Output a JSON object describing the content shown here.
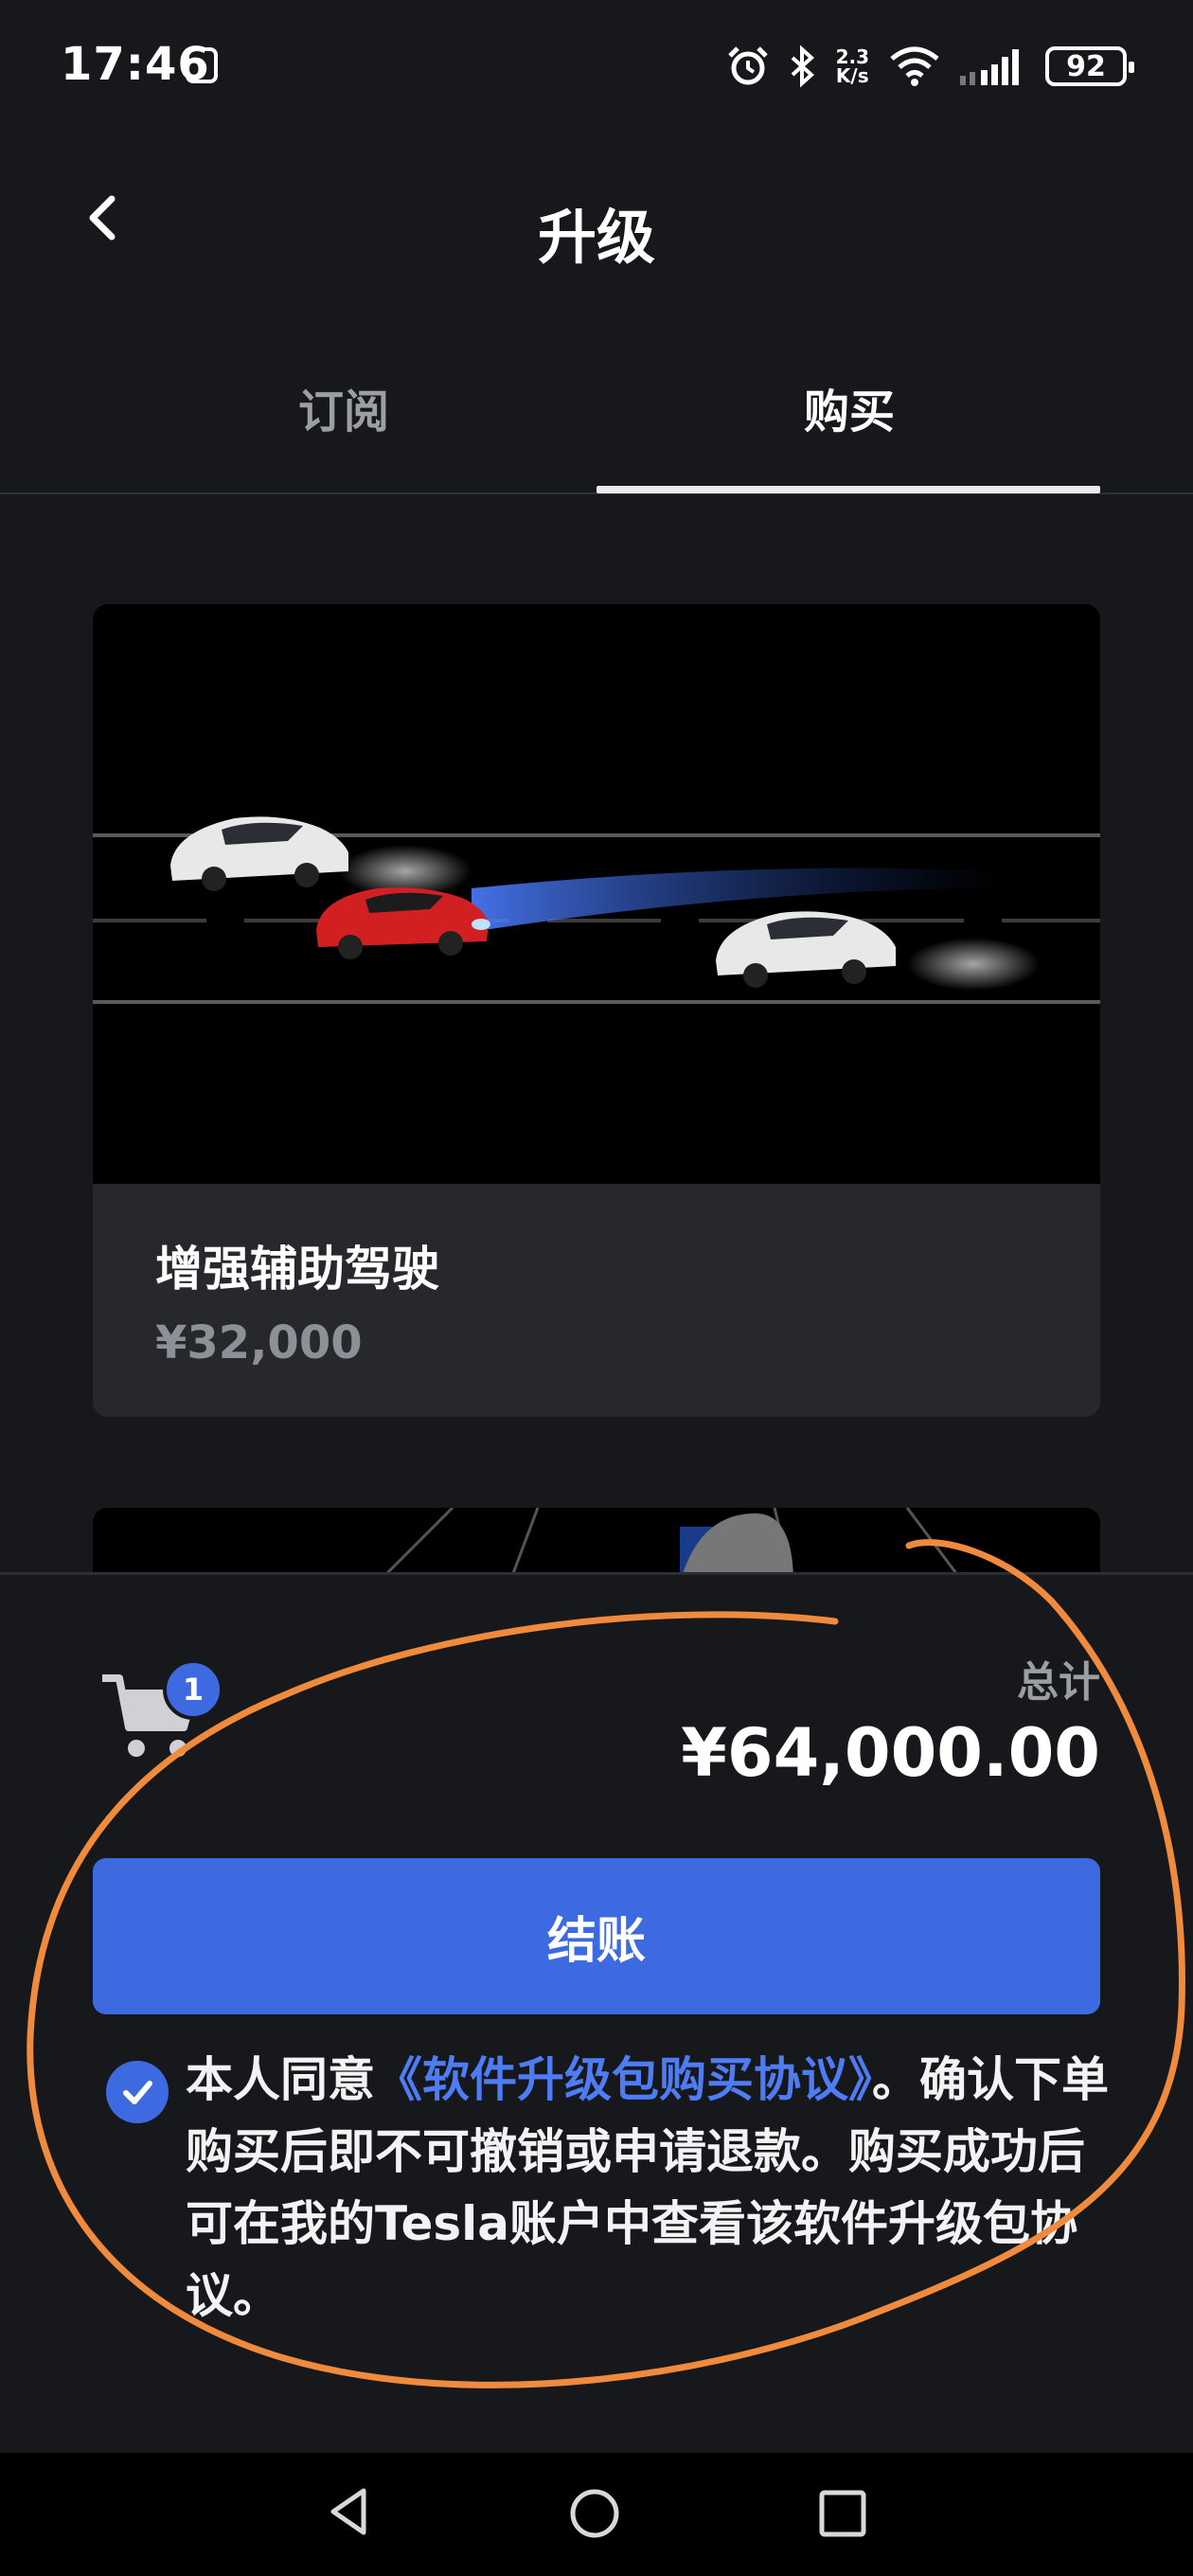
{
  "status_bar": {
    "time": "17:46",
    "network_speed_value": "2.3",
    "network_speed_unit": "K/s",
    "battery": "92"
  },
  "header": {
    "title": "升级"
  },
  "tabs": [
    {
      "label": "订阅",
      "active": false
    },
    {
      "label": "购买",
      "active": true
    }
  ],
  "product_card": {
    "title": "增强辅助驾驶",
    "price": "¥32,000"
  },
  "cart": {
    "badge_count": "1",
    "total_label": "总计",
    "total_amount": "¥64,000.00"
  },
  "checkout": {
    "button_label": "结账"
  },
  "agreement": {
    "checked": true,
    "text_prefix": "本人同意",
    "link_text": "《软件升级包购买协议》",
    "text_suffix": "。确认下单购买后即不可撤销或申请退款。购买成功后可在我的Tesla账户中查看该软件升级包协议。"
  },
  "colors": {
    "accent": "#3e6ae1",
    "link": "#4d7cf5",
    "annotation": "#f08a3c"
  },
  "icons": [
    "nfc-icon",
    "alarm-icon",
    "bluetooth-icon",
    "wifi-icon",
    "signal-icon",
    "battery-icon",
    "back-icon",
    "cart-icon",
    "check-icon",
    "nav-back-icon",
    "nav-home-icon",
    "nav-recent-icon"
  ]
}
